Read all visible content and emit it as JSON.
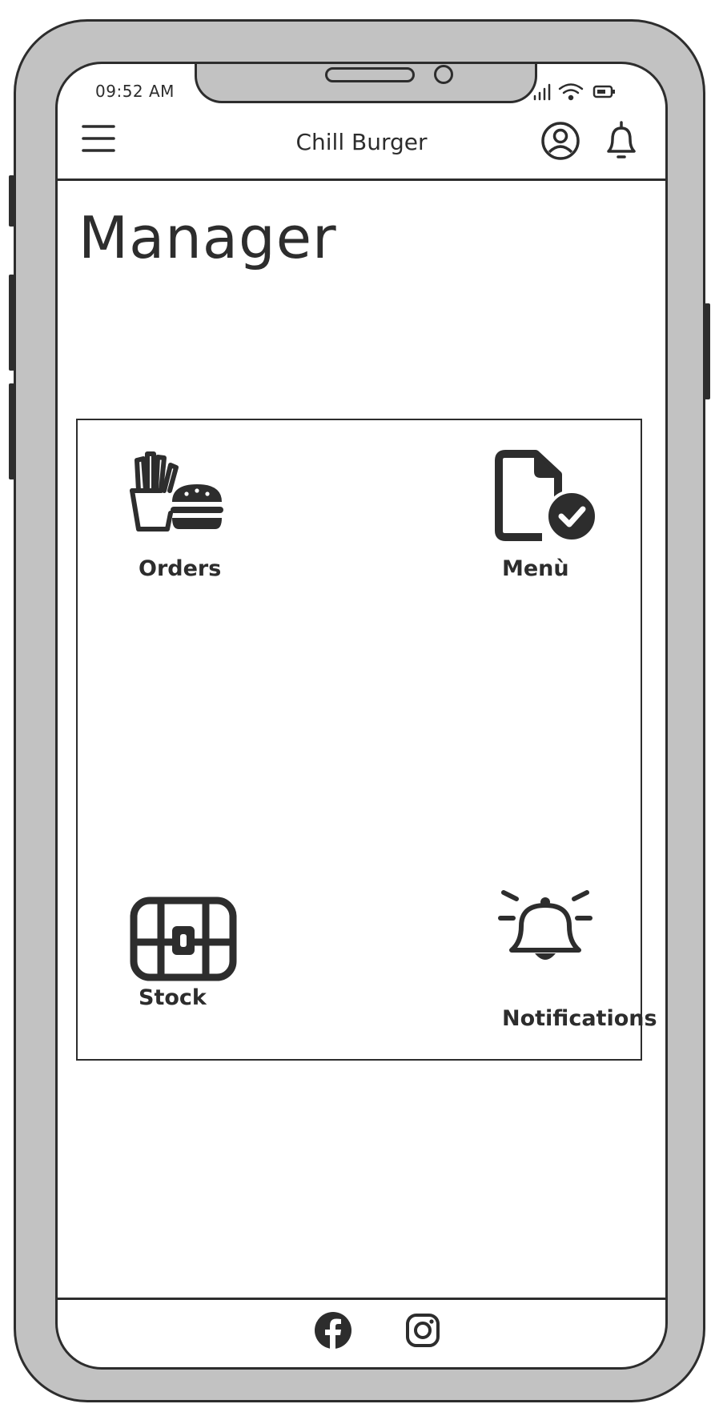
{
  "status_bar": {
    "time": "09:52 AM",
    "icons": [
      "signal-icon",
      "wifi-icon",
      "battery-icon"
    ]
  },
  "header": {
    "title": "Chill Burger",
    "icons": [
      "hamburger-menu-icon",
      "user-account-icon",
      "notification-bell-icon"
    ]
  },
  "page": {
    "title": "Manager"
  },
  "tiles": [
    {
      "label": "Orders",
      "icon": "fries-burger-icon"
    },
    {
      "label": "Menù",
      "icon": "document-check-icon"
    },
    {
      "label": "Stock",
      "icon": "treasure-chest-icon"
    },
    {
      "label": "Notifications",
      "icon": "alarm-bell-icon"
    }
  ],
  "footer": {
    "icons": [
      "facebook-icon",
      "instagram-icon"
    ]
  },
  "colors": {
    "ink": "#2d2d2d",
    "device_body": "#c2c2c2",
    "screen": "#ffffff"
  }
}
